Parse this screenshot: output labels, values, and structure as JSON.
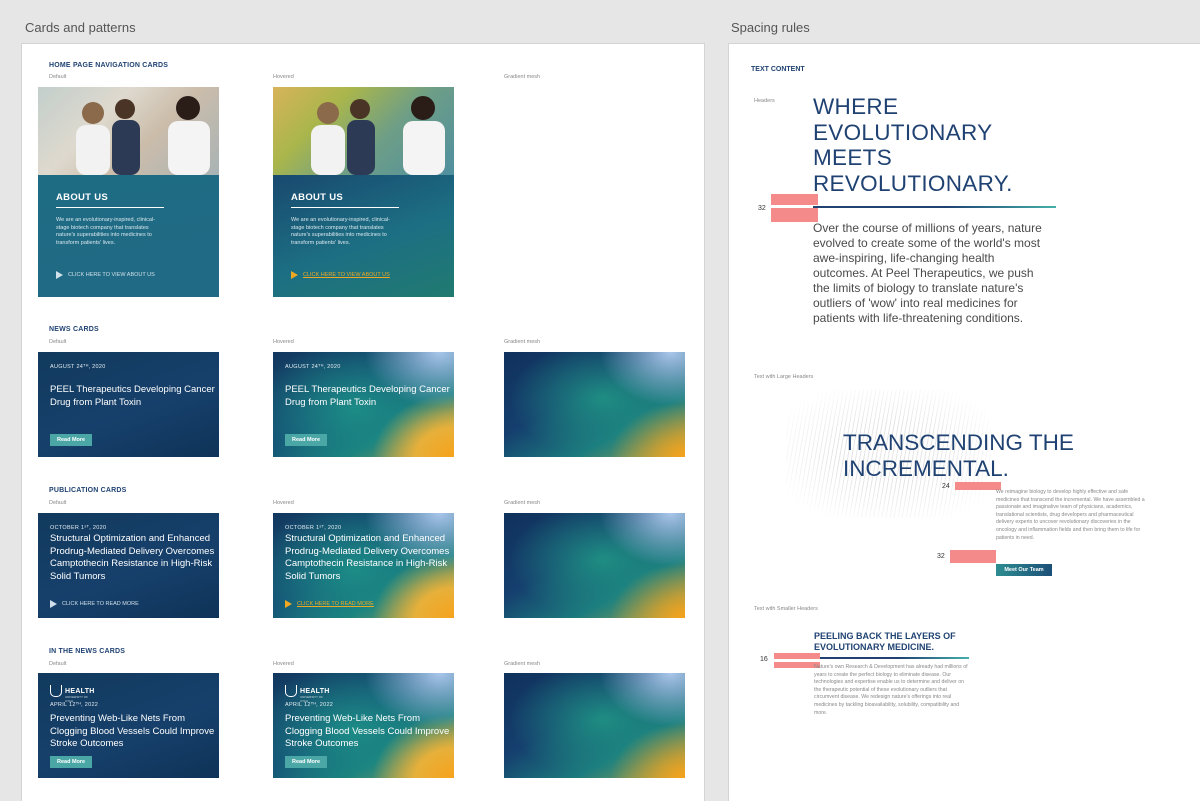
{
  "left_frame": {
    "label": "Cards and patterns"
  },
  "right_frame": {
    "label": "Spacing rules"
  },
  "captions": {
    "default": "Default",
    "hovered": "Hovered",
    "mesh": "Gradient mesh"
  },
  "nav_cards": {
    "section": "HOME PAGE NAVIGATION CARDS",
    "title": "ABOUT US",
    "body": "We are an evolutionary-inspired, clinical-stage biotech company that translates nature's superabilities into medicines to transform patients' lives.",
    "cta": "CLICK HERE TO VIEW ABOUT US"
  },
  "news_cards": {
    "section": "NEWS CARDS",
    "date": "AUGUST 24ᵀᴴ, 2020",
    "title": "PEEL Therapeutics Developing Cancer Drug from Plant Toxin",
    "button": "Read More"
  },
  "publication_cards": {
    "section": "PUBLICATION CARDS",
    "date": "OCTOBER 1ˢᵀ, 2020",
    "title": "Structural Optimization and Enhanced Prodrug-Mediated Delivery Overcomes Camptothecin Resistance in High-Risk Solid Tumors",
    "cta": "CLICK HERE TO READ MORE"
  },
  "inthenews_cards": {
    "section": "IN THE NEWS CARDS",
    "logo": "HEALTH",
    "logo_sub": "UNIVERSITY OF UTAH",
    "date": "APRIL 12ᵀᴴ, 2022",
    "title": "Preventing Web-Like Nets From Clogging Blood Vessels Could Improve Stroke Outcomes",
    "button": "Read More"
  },
  "spacing": {
    "section": "TEXT CONTENT",
    "headers_label": "Headers",
    "headline": "WHERE EVOLUTIONARY MEETS REVOLUTIONARY.",
    "num_32a": "32",
    "paragraph": "Over the course of millions of years, nature evolved to create some of the world's most awe-inspiring, life-changing health outcomes. At Peel Therapeutics, we push the limits of biology to translate nature's outliers of 'wow' into real medicines for patients with life-threatening conditions.",
    "large_label": "Text with Large Headers",
    "large_headline": "TRANSCENDING THE INCREMENTAL.",
    "num_24": "24",
    "large_body": "We reimagine biology to develop highly effective and safe medicines that transcend the incremental. We have assembled a passionate and imaginative team of physicians, academics, translational scientists, drug developers and pharmaceutical delivery experts to uncover revolutionary discoveries in the oncology and inflammation fields and then bring them to life for patients in need.",
    "num_32b": "32",
    "team_button": "Meet Our Team",
    "smaller_label": "Text with Smaller Headers",
    "smaller_headline": "PEELING BACK THE LAYERS OF EVOLUTIONARY MEDICINE.",
    "num_16": "16",
    "smaller_body": "Nature's own Research & Development has already had millions of years to create the perfect biology to eliminate disease. Our technologies and expertise enable us to determine and deliver on the therapeutic potential of these evolutionary outliers that circumvent disease. We redesign nature's offerings into real medicines by tackling bioavailability, solubility, compatibility and more."
  },
  "colors": {
    "navy": "#1f4272",
    "teal": "#4aa7a6",
    "orange": "#f7a21b",
    "pink": "#f58a8a"
  }
}
